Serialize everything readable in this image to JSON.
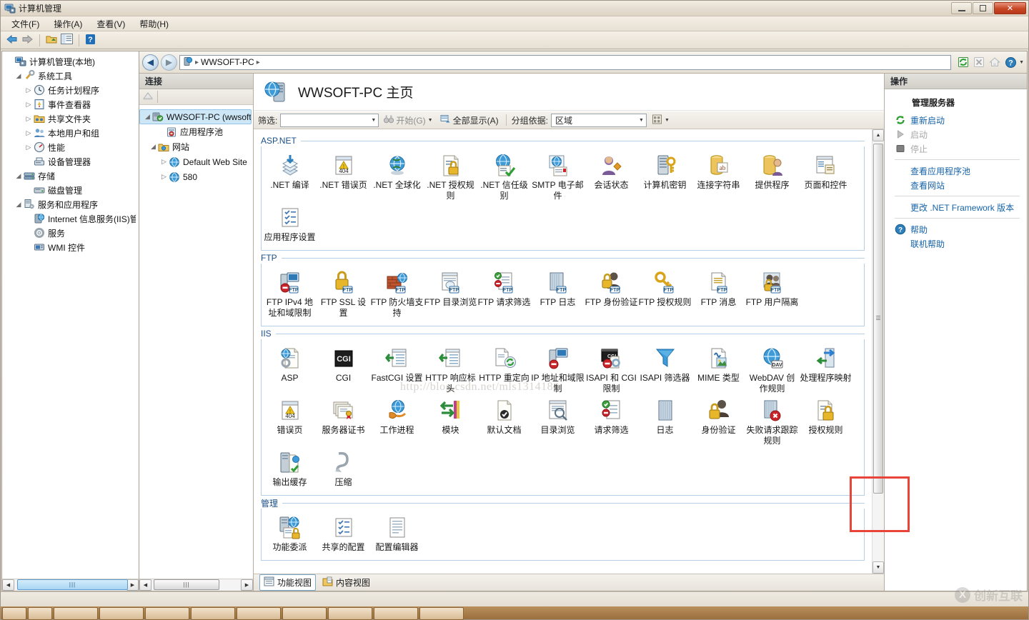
{
  "window": {
    "title": "计算机管理",
    "icon": "computer-management-icon",
    "minimize_label": "最小化",
    "maximize_label": "最大化",
    "close_label": "关闭"
  },
  "menubar": [
    {
      "label": "文件(F)"
    },
    {
      "label": "操作(A)"
    },
    {
      "label": "查看(V)"
    },
    {
      "label": "帮助(H)"
    }
  ],
  "toolbar": [
    {
      "name": "back-icon",
      "glyph": "⇦"
    },
    {
      "name": "forward-icon",
      "glyph": "⇨"
    },
    {
      "name": "up-folder-icon",
      "glyph": "⬆"
    },
    {
      "name": "show-hide-tree-icon",
      "glyph": "▤"
    },
    {
      "name": "help-icon",
      "glyph": "?"
    }
  ],
  "mmc_tree": [
    {
      "label": "计算机管理(本地)",
      "indent": 0,
      "expander": "",
      "icon": "computer-icon"
    },
    {
      "label": "系统工具",
      "indent": 1,
      "expander": "◢",
      "icon": "system-tools-icon"
    },
    {
      "label": "任务计划程序",
      "indent": 2,
      "expander": "▷",
      "icon": "task-scheduler-icon"
    },
    {
      "label": "事件查看器",
      "indent": 2,
      "expander": "▷",
      "icon": "event-viewer-icon"
    },
    {
      "label": "共享文件夹",
      "indent": 2,
      "expander": "▷",
      "icon": "shared-folders-icon"
    },
    {
      "label": "本地用户和组",
      "indent": 2,
      "expander": "▷",
      "icon": "local-users-groups-icon"
    },
    {
      "label": "性能",
      "indent": 2,
      "expander": "▷",
      "icon": "performance-icon"
    },
    {
      "label": "设备管理器",
      "indent": 2,
      "expander": "",
      "icon": "device-manager-icon"
    },
    {
      "label": "存储",
      "indent": 1,
      "expander": "◢",
      "icon": "storage-icon"
    },
    {
      "label": "磁盘管理",
      "indent": 2,
      "expander": "",
      "icon": "disk-management-icon"
    },
    {
      "label": "服务和应用程序",
      "indent": 1,
      "expander": "◢",
      "icon": "services-applications-icon"
    },
    {
      "label": "Internet 信息服务(IIS)管理器",
      "indent": 2,
      "expander": "",
      "icon": "iis-manager-icon"
    },
    {
      "label": "服务",
      "indent": 2,
      "expander": "",
      "icon": "services-icon"
    },
    {
      "label": "WMI 控件",
      "indent": 2,
      "expander": "",
      "icon": "wmi-control-icon"
    }
  ],
  "address": {
    "back_label": "后退",
    "forward_label": "前进",
    "crumbs": [
      "WWSOFT-PC"
    ],
    "separator": "▸",
    "tools": [
      "refresh-icon",
      "stop-icon",
      "home-icon",
      "help-icon"
    ]
  },
  "connections": {
    "header": "连接",
    "toolbar_icon": "connect-to-server-icon",
    "tree": [
      {
        "label": "WWSOFT-PC (wwsoft-PC\\Administrator)",
        "indent": 0,
        "expander": "◢",
        "icon": "server-icon",
        "selected": true
      },
      {
        "label": "应用程序池",
        "indent": 1,
        "expander": "",
        "icon": "app-pools-icon",
        "selected": false
      },
      {
        "label": "网站",
        "indent": 1,
        "expander": "◢",
        "icon": "sites-folder-icon",
        "selected": false
      },
      {
        "label": "Default Web Site",
        "indent": 2,
        "expander": "▷",
        "icon": "website-icon",
        "selected": false
      },
      {
        "label": "580",
        "indent": 2,
        "expander": "▷",
        "icon": "website-icon",
        "selected": false
      }
    ]
  },
  "feature_view": {
    "title": "WWSOFT-PC 主页",
    "title_icon": "server-home-icon",
    "filter": {
      "label": "筛选:",
      "value": "",
      "placeholder": "",
      "go_label": "开始(G)",
      "go_icon": "binoculars-icon",
      "show_all_label": "全部显示(A)",
      "show_all_icon": "show-all-icon",
      "group_by_label": "分组依据:",
      "group_by_value": "区域",
      "view_mode_icon": "view-mode-icon"
    },
    "groups": [
      {
        "name": "ASP.NET",
        "items": [
          {
            "label": ".NET 编译",
            "icon": "net-compilation-icon"
          },
          {
            "label": ".NET 错误页",
            "icon": "net-error-pages-icon"
          },
          {
            "label": ".NET 全球化",
            "icon": "net-globalization-icon"
          },
          {
            "label": ".NET 授权规则",
            "icon": "net-authorization-rules-icon"
          },
          {
            "label": ".NET 信任级别",
            "icon": "net-trust-levels-icon"
          },
          {
            "label": "SMTP 电子邮件",
            "icon": "smtp-email-icon"
          },
          {
            "label": "会话状态",
            "icon": "session-state-icon"
          },
          {
            "label": "计算机密钥",
            "icon": "machine-key-icon"
          },
          {
            "label": "连接字符串",
            "icon": "connection-strings-icon"
          },
          {
            "label": "提供程序",
            "icon": "providers-icon"
          },
          {
            "label": "页面和控件",
            "icon": "pages-and-controls-icon"
          },
          {
            "label": "应用程序设置",
            "icon": "application-settings-icon"
          }
        ]
      },
      {
        "name": "FTP",
        "items": [
          {
            "label": "FTP IPv4 地址和域限制",
            "icon": "ftp-ipv4-restrictions-icon"
          },
          {
            "label": "FTP SSL 设置",
            "icon": "ftp-ssl-settings-icon"
          },
          {
            "label": "FTP 防火墙支持",
            "icon": "ftp-firewall-support-icon"
          },
          {
            "label": "FTP 目录浏览",
            "icon": "ftp-directory-browsing-icon"
          },
          {
            "label": "FTP 请求筛选",
            "icon": "ftp-request-filtering-icon"
          },
          {
            "label": "FTP 日志",
            "icon": "ftp-logging-icon"
          },
          {
            "label": "FTP 身份验证",
            "icon": "ftp-authentication-icon"
          },
          {
            "label": "FTP 授权规则",
            "icon": "ftp-authorization-rules-icon"
          },
          {
            "label": "FTP 消息",
            "icon": "ftp-messages-icon"
          },
          {
            "label": "FTP 用户隔离",
            "icon": "ftp-user-isolation-icon"
          }
        ]
      },
      {
        "name": "IIS",
        "items": [
          {
            "label": "ASP",
            "icon": "asp-icon"
          },
          {
            "label": "CGI",
            "icon": "cgi-icon"
          },
          {
            "label": "FastCGI 设置",
            "icon": "fastcgi-settings-icon"
          },
          {
            "label": "HTTP 响应标头",
            "icon": "http-response-headers-icon"
          },
          {
            "label": "HTTP 重定向",
            "icon": "http-redirect-icon"
          },
          {
            "label": "IP 地址和域限制",
            "icon": "ip-domain-restrictions-icon"
          },
          {
            "label": "ISAPI 和 CGI 限制",
            "icon": "isapi-cgi-restrictions-icon",
            "highlighted": true
          },
          {
            "label": "ISAPI 筛选器",
            "icon": "isapi-filters-icon"
          },
          {
            "label": "MIME 类型",
            "icon": "mime-types-icon"
          },
          {
            "label": "WebDAV 创作规则",
            "icon": "webdav-authoring-rules-icon"
          },
          {
            "label": "处理程序映射",
            "icon": "handler-mappings-icon"
          },
          {
            "label": "错误页",
            "icon": "error-pages-icon"
          },
          {
            "label": "服务器证书",
            "icon": "server-certificates-icon"
          },
          {
            "label": "工作进程",
            "icon": "worker-processes-icon"
          },
          {
            "label": "模块",
            "icon": "modules-icon"
          },
          {
            "label": "默认文档",
            "icon": "default-document-icon"
          },
          {
            "label": "目录浏览",
            "icon": "directory-browsing-icon"
          },
          {
            "label": "请求筛选",
            "icon": "request-filtering-icon"
          },
          {
            "label": "日志",
            "icon": "logging-icon"
          },
          {
            "label": "身份验证",
            "icon": "authentication-icon"
          },
          {
            "label": "失败请求跟踪规则",
            "icon": "failed-request-tracing-rules-icon"
          },
          {
            "label": "授权规则",
            "icon": "authorization-rules-icon"
          },
          {
            "label": "输出缓存",
            "icon": "output-caching-icon"
          },
          {
            "label": "压缩",
            "icon": "compression-icon"
          }
        ]
      },
      {
        "name": "管理",
        "items": [
          {
            "label": "功能委派",
            "icon": "feature-delegation-icon"
          },
          {
            "label": "共享的配置",
            "icon": "shared-configuration-icon"
          },
          {
            "label": "配置编辑器",
            "icon": "configuration-editor-icon"
          }
        ]
      }
    ]
  },
  "actions": {
    "header": "操作",
    "group_title": "管理服务器",
    "items": [
      {
        "label": "重新启动",
        "icon": "restart-icon",
        "disabled": false,
        "sep_after": false
      },
      {
        "label": "启动",
        "icon": "start-icon",
        "disabled": true,
        "sep_after": false
      },
      {
        "label": "停止",
        "icon": "stop-icon",
        "disabled": true,
        "sep_after": true
      },
      {
        "label": "查看应用程序池",
        "icon": "",
        "disabled": false,
        "sep_after": false
      },
      {
        "label": "查看网站",
        "icon": "",
        "disabled": false,
        "sep_after": true
      },
      {
        "label": "更改 .NET Framework 版本",
        "icon": "",
        "disabled": false,
        "sep_after": true
      },
      {
        "label": "帮助",
        "icon": "help-icon",
        "disabled": false,
        "sep_after": false
      },
      {
        "label": "联机帮助",
        "icon": "",
        "disabled": false,
        "sep_after": false
      }
    ]
  },
  "view_tabs": [
    {
      "label": "功能视图",
      "icon": "features-view-icon",
      "active": true
    },
    {
      "label": "内容视图",
      "icon": "content-view-icon",
      "active": false
    }
  ],
  "watermarks": {
    "main": "http://blog.csdn.net/mls1314180",
    "logo_mark": "X",
    "logo_text": "创新互联"
  },
  "colors": {
    "accent": "#1663a8",
    "group_header": "#1a4f86",
    "highlight_box": "#e8443a",
    "selection": "#cde7f7"
  }
}
